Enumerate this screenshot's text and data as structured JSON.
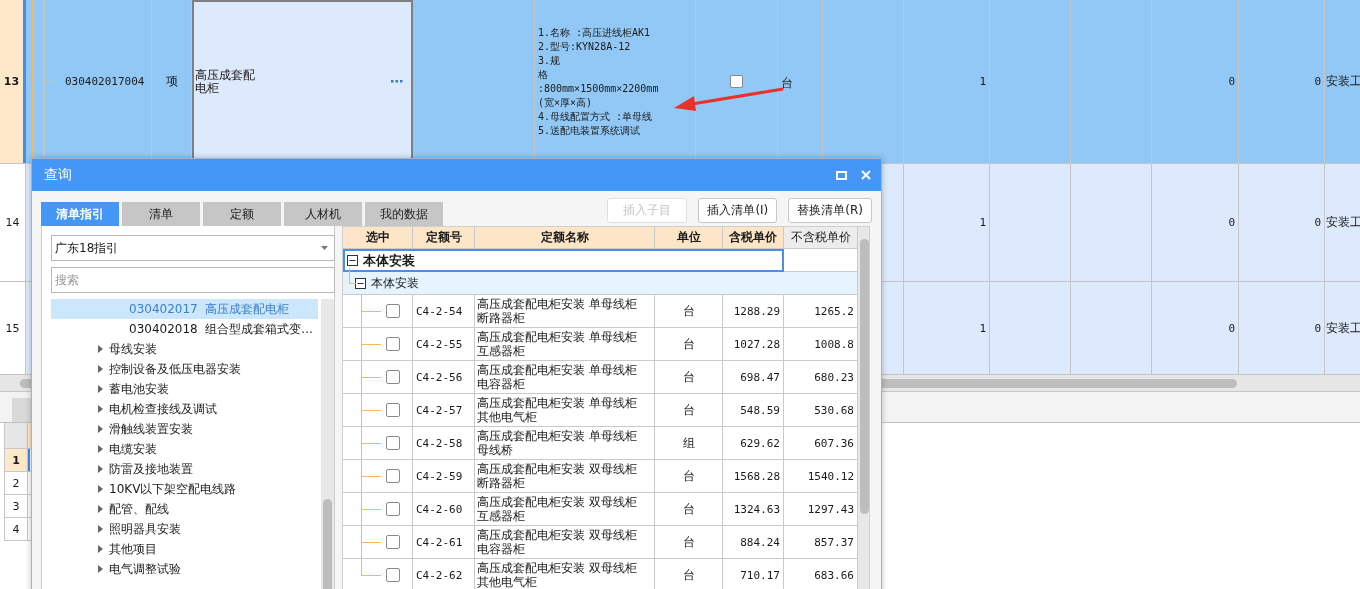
{
  "main_table": {
    "rows": [
      {
        "number": "13",
        "selected": true,
        "code": "030402017004",
        "type": "项",
        "name": "高压成套配电柜",
        "description": [
          "1.名称 :高压进线柜AK1",
          "2.型号:KYN28A-12",
          "3.规",
          "格",
          ":800mm×1500mm×2200mm",
          "(宽×厚×高)",
          "4.母线配置方式 :单母线",
          "5.送配电装置系统调试"
        ],
        "checked": false,
        "unit": "台",
        "quantity": "1",
        "column_13": "0",
        "column_14": "0",
        "column_15": "安装工"
      },
      {
        "number": "14",
        "selected": false,
        "quantity": "1",
        "column_13": "0",
        "column_14": "0",
        "column_15": "安装工"
      },
      {
        "number": "15",
        "selected": false,
        "quantity": "1",
        "column_13": "0",
        "column_14": "0",
        "column_15": "安装工"
      }
    ]
  },
  "lower_table": {
    "rows": [
      {
        "number": "1",
        "selected": true
      },
      {
        "number": "2",
        "selected": false
      },
      {
        "number": "3",
        "selected": false
      },
      {
        "number": "4",
        "selected": false
      }
    ]
  },
  "dialog": {
    "title": "查询",
    "tabs": [
      {
        "label": "清单指引",
        "selected": true
      },
      {
        "label": "清单",
        "selected": false
      },
      {
        "label": "定额",
        "selected": false
      },
      {
        "label": "人材机",
        "selected": false
      },
      {
        "label": "我的数据",
        "selected": false
      }
    ],
    "buttons": [
      {
        "label": "插入子目",
        "disabled": true
      },
      {
        "label": "插入清单(I)",
        "disabled": false
      },
      {
        "label": "替换清单(R)",
        "disabled": false
      }
    ],
    "guide_select": "广东18指引",
    "search": {
      "placeholder": "搜索"
    },
    "tree": [
      {
        "children": [
          {
            "children": [
              {
                "code": "030402017",
                "label": "高压成套配电柜",
                "selected": true
              },
              {
                "code": "030402018",
                "label": "组合型成套箱式变...",
                "selected": false
              }
            ]
          },
          {
            "label": "母线安装",
            "expanded": false,
            "selected": false
          },
          {
            "label": "控制设备及低压电器安装",
            "expanded": false,
            "selected": false
          },
          {
            "label": "蓄电池安装",
            "expanded": false,
            "selected": false
          },
          {
            "label": "电机检查接线及调试",
            "expanded": false,
            "selected": false
          },
          {
            "label": "滑触线装置安装",
            "expanded": false,
            "selected": false
          },
          {
            "label": "电缆安装",
            "expanded": false,
            "selected": false
          },
          {
            "label": "防雷及接地装置",
            "expanded": false,
            "selected": false
          },
          {
            "label": "10KV以下架空配电线路",
            "expanded": false,
            "selected": false
          },
          {
            "label": "配管、配线",
            "expanded": false,
            "selected": false
          },
          {
            "label": "照明器具安装",
            "expanded": false,
            "selected": false
          },
          {
            "label": "其他项目",
            "expanded": false,
            "selected": false
          },
          {
            "label": "电气调整试验",
            "expanded": false,
            "selected": false
          }
        ]
      }
    ],
    "quota_grid": {
      "columns": [
        {
          "label": "选中",
          "highlighted": true
        },
        {
          "label": "定额号",
          "highlighted": true
        },
        {
          "label": "定额名称",
          "highlighted": true
        },
        {
          "label": "单位",
          "highlighted": true
        },
        {
          "label": "含税单价",
          "highlighted": true
        },
        {
          "label": "不含税单价",
          "highlighted": false
        }
      ],
      "groups": [
        {
          "label": "本体安装",
          "expanded": true,
          "children": [
            {
              "label": "本体安装",
              "expanded": true,
              "rows": [
                {
                  "checked": false,
                  "code": "C4-2-54",
                  "name": "高压成套配电柜安装 单母线柜断路器柜",
                  "unit": "台",
                  "price_tax": "1288.29",
                  "price_notax": "1265.2"
                },
                {
                  "checked": false,
                  "code": "C4-2-55",
                  "name": "高压成套配电柜安装 单母线柜互感器柜",
                  "unit": "台",
                  "price_tax": "1027.28",
                  "price_notax": "1008.8"
                },
                {
                  "checked": false,
                  "code": "C4-2-56",
                  "name": "高压成套配电柜安装 单母线柜电容器柜",
                  "unit": "台",
                  "price_tax": "698.47",
                  "price_notax": "680.23"
                },
                {
                  "checked": false,
                  "code": "C4-2-57",
                  "name": "高压成套配电柜安装 单母线柜其他电气柜",
                  "unit": "台",
                  "price_tax": "548.59",
                  "price_notax": "530.68"
                },
                {
                  "checked": false,
                  "code": "C4-2-58",
                  "name": "高压成套配电柜安装 单母线柜母线桥",
                  "unit": "组",
                  "price_tax": "629.62",
                  "price_notax": "607.36"
                },
                {
                  "checked": false,
                  "code": "C4-2-59",
                  "name": "高压成套配电柜安装 双母线柜断路器柜",
                  "unit": "台",
                  "price_tax": "1568.28",
                  "price_notax": "1540.12"
                },
                {
                  "checked": false,
                  "code": "C4-2-60",
                  "name": "高压成套配电柜安装 双母线柜互感器柜",
                  "unit": "台",
                  "price_tax": "1324.63",
                  "price_notax": "1297.43"
                },
                {
                  "checked": false,
                  "code": "C4-2-61",
                  "name": "高压成套配电柜安装 双母线柜电容器柜",
                  "unit": "台",
                  "price_tax": "884.24",
                  "price_notax": "857.37"
                },
                {
                  "checked": false,
                  "code": "C4-2-62",
                  "name": "高压成套配电柜安装 双母线柜其他电气柜",
                  "unit": "台",
                  "price_tax": "710.17",
                  "price_notax": "683.66"
                }
              ]
            }
          ]
        }
      ]
    }
  }
}
